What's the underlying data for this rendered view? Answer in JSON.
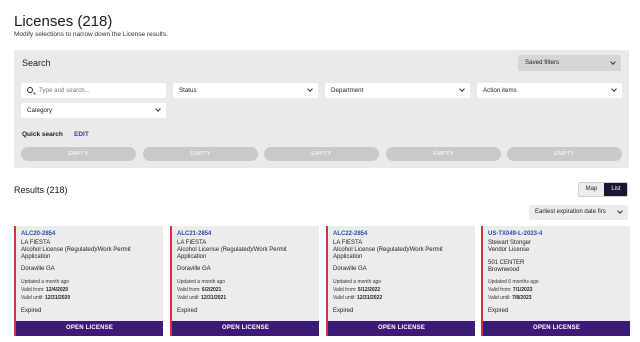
{
  "header": {
    "title": "Licenses (218)",
    "subtitle": "Modify selections to narrow down the License results."
  },
  "search": {
    "title": "Search",
    "saved_filters": "Saved filters",
    "search_placeholder": "Type and search...",
    "filters": [
      "Status",
      "Department",
      "Action items",
      "Category"
    ],
    "quick_search_label": "Quick search",
    "edit_label": "EDIT",
    "quick_slots": [
      "EMPTY",
      "EMPTY",
      "EMPTY",
      "EMPTY",
      "EMPTY"
    ]
  },
  "results": {
    "title": "Results (218)",
    "view_map": "Map",
    "view_list": "List",
    "active_view": "List",
    "sort": "Earliest expiration date firs",
    "cards": [
      {
        "id": "ALC20-2854",
        "name": "LA FIESTA",
        "type": "Alcohol License (Regulated)/Work Permit Application",
        "location": "Doraville GA",
        "updated": "Updated a month ago",
        "valid_from_label": "Valid from:",
        "valid_from": "12/4/2020",
        "valid_until_label": "Valid until:",
        "valid_until": "12/31/2020",
        "status": "Expired",
        "button": "OPEN LICENSE"
      },
      {
        "id": "ALC21-2854",
        "name": "LA FIESTA",
        "type": "Alcohol License (Regulated)/Work Permit Application",
        "location": "Doraville GA",
        "updated": "Updated a month ago",
        "valid_from_label": "Valid from:",
        "valid_from": "6/2/2021",
        "valid_until_label": "Valid until:",
        "valid_until": "12/31/2021",
        "status": "Expired",
        "button": "OPEN LICENSE"
      },
      {
        "id": "ALC22-2854",
        "name": "LA FIESTA",
        "type": "Alcohol License (Regulated)/Work Permit Application",
        "location": "Doraville GA",
        "updated": "Updated a month ago",
        "valid_from_label": "Valid from:",
        "valid_from": "5/12/2022",
        "valid_until_label": "Valid until:",
        "valid_until": "12/31/2022",
        "status": "Expired",
        "button": "OPEN LICENSE"
      },
      {
        "id": "US-TX049-L-2023-4",
        "name": "Stewart Stonger",
        "type": "Vendor License",
        "address1": "501 CENTER",
        "address2": "Brownwood",
        "updated": "Updated 6 months ago",
        "valid_from_label": "Valid from:",
        "valid_from": "7/1/2023",
        "valid_until_label": "Valid until:",
        "valid_until": "7/8/2023",
        "status": "Expired",
        "button": "OPEN LICENSE"
      }
    ]
  },
  "colors": {
    "accent_purple": "#3c1a78",
    "edit_purple": "#5b2aa3",
    "id_blue": "#2a4bb8",
    "card_accent_red": "#d9304a",
    "toggle_active": "#1a1533"
  }
}
